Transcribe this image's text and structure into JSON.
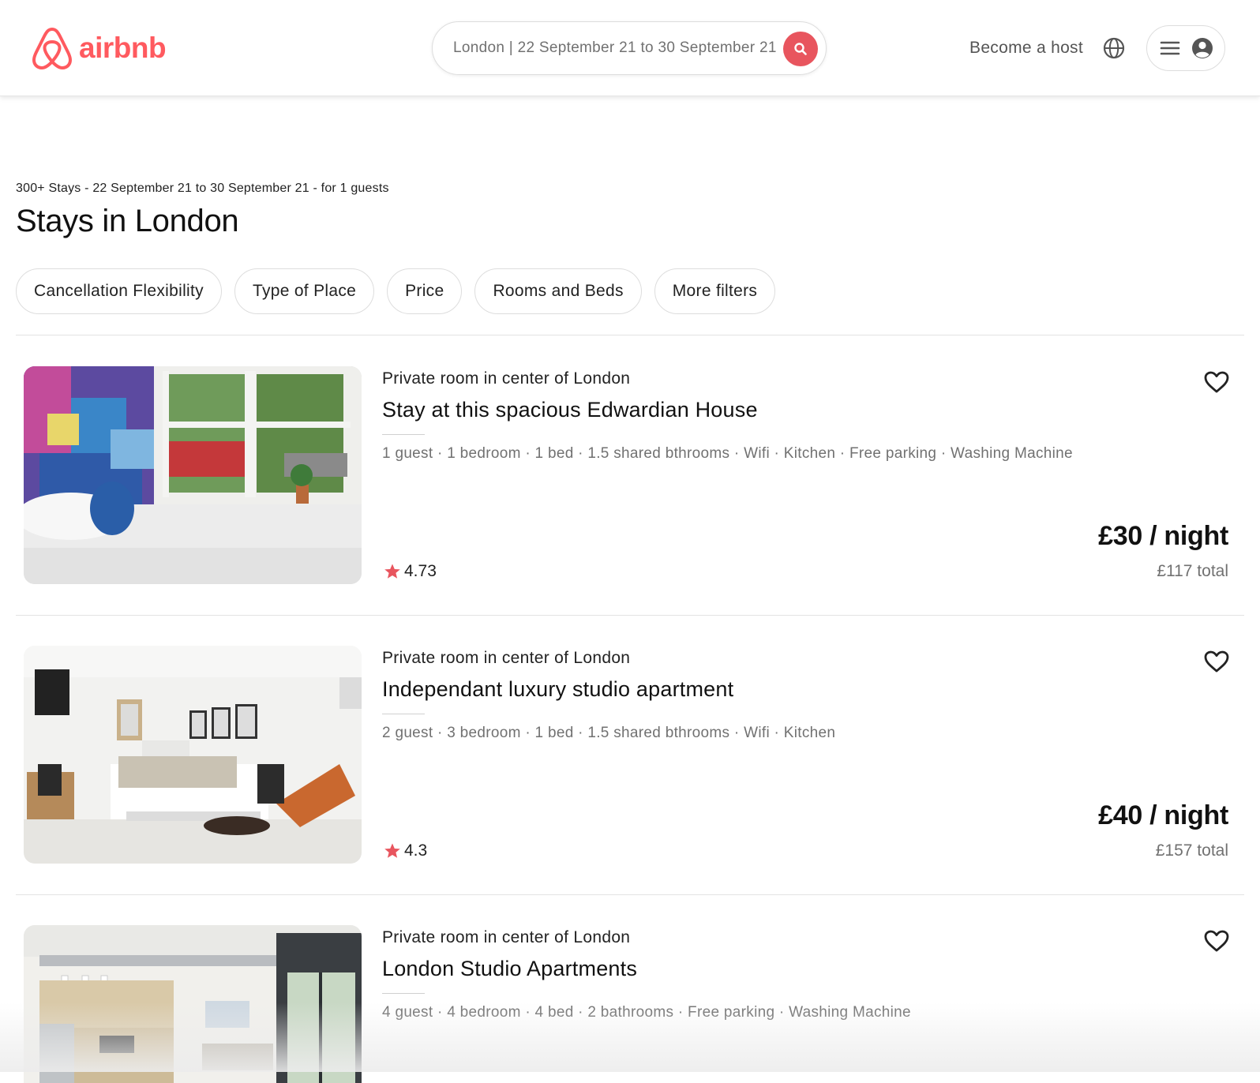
{
  "brand": {
    "name": "airbnb",
    "color": "#FF5A5F"
  },
  "search": {
    "value": "London | 22 September 21 to 30 September 21",
    "icon": "search-icon"
  },
  "nav": {
    "host_label": "Become a host",
    "globe_icon": "globe-icon",
    "menu_icon": "hamburger-menu-icon",
    "user_icon": "user-avatar-icon"
  },
  "results": {
    "summary": "300+ Stays - 22 September 21 to 30 September 21 - for 1 guests",
    "title": "Stays in London"
  },
  "filters": [
    "Cancellation Flexibility",
    "Type of Place",
    "Price",
    "Rooms and Beds",
    "More filters"
  ],
  "listings": [
    {
      "subtitle": "Private room in center of London",
      "name": "Stay at this spacious Edwardian House",
      "amenities": "1 guest · 1 bedroom · 1 bed · 1.5 shared bthrooms · Wifi · Kitchen · Free parking · Washing Machine",
      "rating": "4.73",
      "price": "£30 / night",
      "total": "£117 total"
    },
    {
      "subtitle": "Private room in center of London",
      "name": "Independant luxury studio apartment",
      "amenities": "2 guest · 3 bedroom · 1 bed · 1.5 shared bthrooms · Wifi · Kitchen",
      "rating": "4.3",
      "price": "£40 / night",
      "total": "£157 total"
    },
    {
      "subtitle": "Private room in center of London",
      "name": "London Studio Apartments",
      "amenities": "4 guest · 4 bedroom · 4 bed · 2 bathrooms · Free parking · Washing Machine",
      "rating": "",
      "price": "",
      "total": ""
    }
  ],
  "colors": {
    "accent": "#FF5A5F",
    "search_button": "#E8555E",
    "muted_text": "#717171"
  }
}
